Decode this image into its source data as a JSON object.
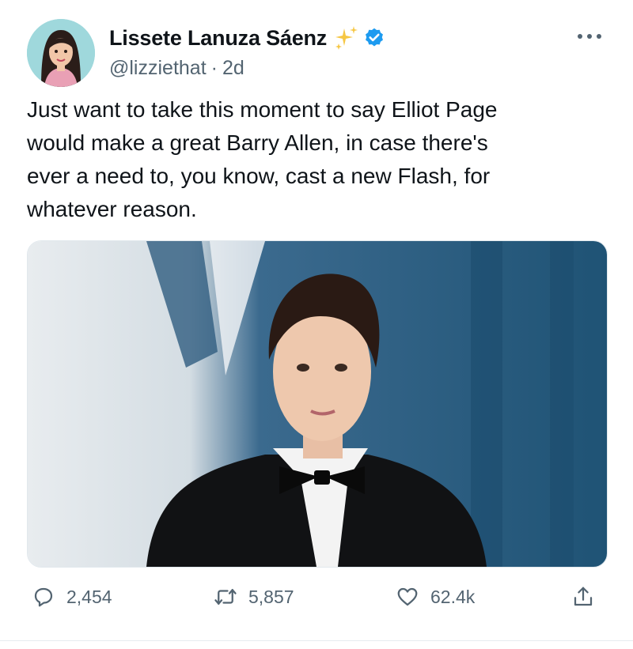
{
  "author": {
    "display_name": "Lissete Lanuza Sáenz",
    "handle": "@lizziethat",
    "separator": "·",
    "time_ago": "2d",
    "verified": true
  },
  "tweet": {
    "text": "Just want to take this moment to say Elliot Page\nwould make a great Barry Allen, in case there's\never a need to, you know, cast a new Flash, for\nwhatever reason."
  },
  "actions": {
    "replies": "2,454",
    "retweets": "5,857",
    "likes": "62.4k"
  },
  "colors": {
    "text": "#0f1419",
    "secondary": "#536471",
    "verified": "#1d9bf0",
    "sparkle": "#f6c744"
  },
  "icons": {
    "reply": "reply-icon",
    "retweet": "retweet-icon",
    "like": "heart-icon",
    "share": "share-icon",
    "more": "more-icon",
    "verified": "verified-icon",
    "sparkles": "sparkles-icon"
  }
}
